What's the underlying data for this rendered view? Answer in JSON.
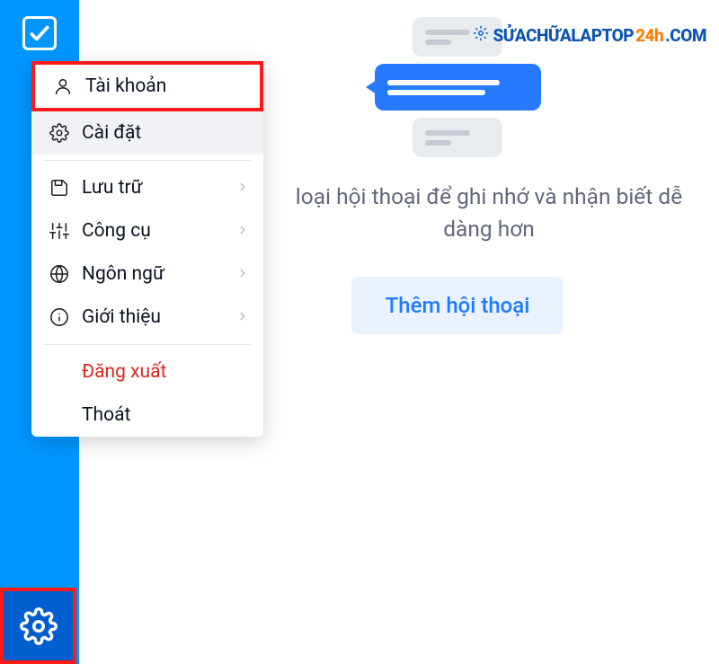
{
  "menu": {
    "account": "Tài khoản",
    "settings": "Cài đặt",
    "storage": "Lưu trữ",
    "tools": "Công cụ",
    "language": "Ngôn ngữ",
    "about": "Giới thiệu",
    "logout": "Đăng xuất",
    "exit": "Thoát"
  },
  "content": {
    "description": "loại hội thoại để ghi nhớ và nhận biết dễ dàng hơn",
    "cta": "Thêm hội thoại"
  },
  "watermark": {
    "a": "SỬACHỮALAPTOP",
    "b": "24h",
    "c": ".com"
  }
}
